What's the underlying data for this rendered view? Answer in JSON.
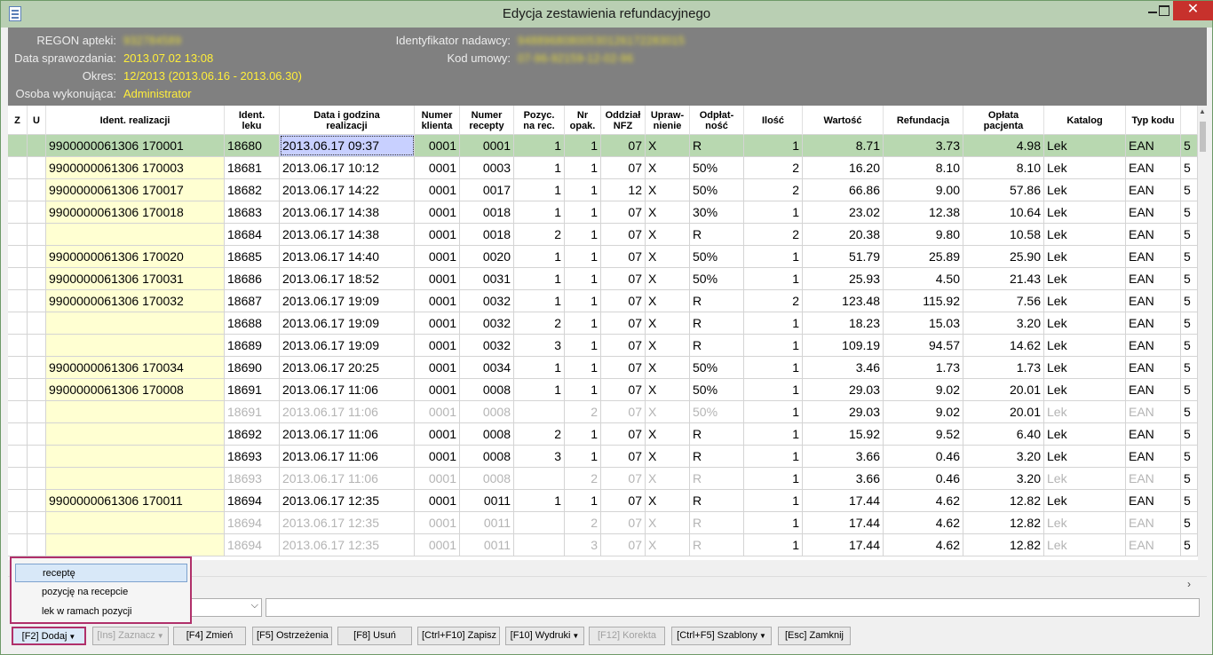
{
  "window": {
    "title": "Edycja zestawienia refundacyjnego"
  },
  "info": {
    "regon_label": "REGON apteki:",
    "regon_value": "932784589",
    "date_label": "Data sprawozdania:",
    "date_value": "2013.07.02 13:08",
    "period_label": "Okres:",
    "period_value": "12/2013 (2013.06.16 - 2013.06.30)",
    "person_label": "Osoba wykonująca:",
    "person_value": "Administrator",
    "sender_label": "Identyfikator nadawcy:",
    "sender_value": "94889680800530126172283015",
    "contract_label": "Kod umowy:",
    "contract_value": "07-96-92159-12-02-96"
  },
  "table": {
    "headers": [
      "Z",
      "U",
      "Ident. realizacji",
      "Ident.\nleku",
      "Data i godzina\nrealizacji",
      "Numer\nklienta",
      "Numer\nrecepty",
      "Pozyc.\nna rec.",
      "Nr\nopak.",
      "Oddział\nNFZ",
      "Upraw-\nnienie",
      "Odpłat-\nność",
      "Ilość",
      "Wartość",
      "Refundacja",
      "Opłata\npacjenta",
      "Katalog",
      "Typ kodu"
    ],
    "rows": [
      {
        "ident": "9900000061306  170001",
        "lek": "18680",
        "date": "2013.06.17 09:37",
        "klient": "0001",
        "recepta": "0001",
        "poz": "1",
        "opak": "1",
        "nfz": "07",
        "upr": "X",
        "odp": "R",
        "ilosc": "1",
        "wart": "8.71",
        "ref": "3.73",
        "opl": "4.98",
        "kat": "Lek",
        "typ": "EAN",
        "extra": "5"
      },
      {
        "ident": "9900000061306  170003",
        "lek": "18681",
        "date": "2013.06.17 10:12",
        "klient": "0001",
        "recepta": "0003",
        "poz": "1",
        "opak": "1",
        "nfz": "07",
        "upr": "X",
        "odp": "50%",
        "ilosc": "2",
        "wart": "16.20",
        "ref": "8.10",
        "opl": "8.10",
        "kat": "Lek",
        "typ": "EAN",
        "extra": "5"
      },
      {
        "ident": "9900000061306  170017",
        "lek": "18682",
        "date": "2013.06.17 14:22",
        "klient": "0001",
        "recepta": "0017",
        "poz": "1",
        "opak": "1",
        "nfz": "12",
        "upr": "X",
        "odp": "50%",
        "ilosc": "2",
        "wart": "66.86",
        "ref": "9.00",
        "opl": "57.86",
        "kat": "Lek",
        "typ": "EAN",
        "extra": "5"
      },
      {
        "ident": "9900000061306  170018",
        "lek": "18683",
        "date": "2013.06.17 14:38",
        "klient": "0001",
        "recepta": "0018",
        "poz": "1",
        "opak": "1",
        "nfz": "07",
        "upr": "X",
        "odp": "30%",
        "ilosc": "1",
        "wart": "23.02",
        "ref": "12.38",
        "opl": "10.64",
        "kat": "Lek",
        "typ": "EAN",
        "extra": "5"
      },
      {
        "ident": "",
        "lek": "18684",
        "date": "2013.06.17 14:38",
        "klient": "0001",
        "recepta": "0018",
        "poz": "2",
        "opak": "1",
        "nfz": "07",
        "upr": "X",
        "odp": "R",
        "ilosc": "2",
        "wart": "20.38",
        "ref": "9.80",
        "opl": "10.58",
        "kat": "Lek",
        "typ": "EAN",
        "extra": "5"
      },
      {
        "ident": "9900000061306  170020",
        "lek": "18685",
        "date": "2013.06.17 14:40",
        "klient": "0001",
        "recepta": "0020",
        "poz": "1",
        "opak": "1",
        "nfz": "07",
        "upr": "X",
        "odp": "50%",
        "ilosc": "1",
        "wart": "51.79",
        "ref": "25.89",
        "opl": "25.90",
        "kat": "Lek",
        "typ": "EAN",
        "extra": "5"
      },
      {
        "ident": "9900000061306  170031",
        "lek": "18686",
        "date": "2013.06.17 18:52",
        "klient": "0001",
        "recepta": "0031",
        "poz": "1",
        "opak": "1",
        "nfz": "07",
        "upr": "X",
        "odp": "50%",
        "ilosc": "1",
        "wart": "25.93",
        "ref": "4.50",
        "opl": "21.43",
        "kat": "Lek",
        "typ": "EAN",
        "extra": "5"
      },
      {
        "ident": "9900000061306  170032",
        "lek": "18687",
        "date": "2013.06.17 19:09",
        "klient": "0001",
        "recepta": "0032",
        "poz": "1",
        "opak": "1",
        "nfz": "07",
        "upr": "X",
        "odp": "R",
        "ilosc": "2",
        "wart": "123.48",
        "ref": "115.92",
        "opl": "7.56",
        "kat": "Lek",
        "typ": "EAN",
        "extra": "5"
      },
      {
        "ident": "",
        "lek": "18688",
        "date": "2013.06.17 19:09",
        "klient": "0001",
        "recepta": "0032",
        "poz": "2",
        "opak": "1",
        "nfz": "07",
        "upr": "X",
        "odp": "R",
        "ilosc": "1",
        "wart": "18.23",
        "ref": "15.03",
        "opl": "3.20",
        "kat": "Lek",
        "typ": "EAN",
        "extra": "5"
      },
      {
        "ident": "",
        "lek": "18689",
        "date": "2013.06.17 19:09",
        "klient": "0001",
        "recepta": "0032",
        "poz": "3",
        "opak": "1",
        "nfz": "07",
        "upr": "X",
        "odp": "R",
        "ilosc": "1",
        "wart": "109.19",
        "ref": "94.57",
        "opl": "14.62",
        "kat": "Lek",
        "typ": "EAN",
        "extra": "5"
      },
      {
        "ident": "9900000061306  170034",
        "lek": "18690",
        "date": "2013.06.17 20:25",
        "klient": "0001",
        "recepta": "0034",
        "poz": "1",
        "opak": "1",
        "nfz": "07",
        "upr": "X",
        "odp": "50%",
        "ilosc": "1",
        "wart": "3.46",
        "ref": "1.73",
        "opl": "1.73",
        "kat": "Lek",
        "typ": "EAN",
        "extra": "5"
      },
      {
        "ident": "9900000061306  170008",
        "lek": "18691",
        "date": "2013.06.17 11:06",
        "klient": "0001",
        "recepta": "0008",
        "poz": "1",
        "opak": "1",
        "nfz": "07",
        "upr": "X",
        "odp": "50%",
        "ilosc": "1",
        "wart": "29.03",
        "ref": "9.02",
        "opl": "20.01",
        "kat": "Lek",
        "typ": "EAN",
        "extra": "5"
      },
      {
        "ident": "",
        "lek": "18691",
        "date": "2013.06.17 11:06",
        "klient": "0001",
        "recepta": "0008",
        "poz": "",
        "opak": "2",
        "nfz": "07",
        "upr": "X",
        "odp": "50%",
        "ilosc": "1",
        "wart": "29.03",
        "ref": "9.02",
        "opl": "20.01",
        "kat": "Lek",
        "typ": "EAN",
        "extra": "5",
        "dim": true
      },
      {
        "ident": "",
        "lek": "18692",
        "date": "2013.06.17 11:06",
        "klient": "0001",
        "recepta": "0008",
        "poz": "2",
        "opak": "1",
        "nfz": "07",
        "upr": "X",
        "odp": "R",
        "ilosc": "1",
        "wart": "15.92",
        "ref": "9.52",
        "opl": "6.40",
        "kat": "Lek",
        "typ": "EAN",
        "extra": "5"
      },
      {
        "ident": "",
        "lek": "18693",
        "date": "2013.06.17 11:06",
        "klient": "0001",
        "recepta": "0008",
        "poz": "3",
        "opak": "1",
        "nfz": "07",
        "upr": "X",
        "odp": "R",
        "ilosc": "1",
        "wart": "3.66",
        "ref": "0.46",
        "opl": "3.20",
        "kat": "Lek",
        "typ": "EAN",
        "extra": "5"
      },
      {
        "ident": "",
        "lek": "18693",
        "date": "2013.06.17 11:06",
        "klient": "0001",
        "recepta": "0008",
        "poz": "",
        "opak": "2",
        "nfz": "07",
        "upr": "X",
        "odp": "R",
        "ilosc": "1",
        "wart": "3.66",
        "ref": "0.46",
        "opl": "3.20",
        "kat": "Lek",
        "typ": "EAN",
        "extra": "5",
        "dim": true
      },
      {
        "ident": "9900000061306  170011",
        "lek": "18694",
        "date": "2013.06.17 12:35",
        "klient": "0001",
        "recepta": "0011",
        "poz": "1",
        "opak": "1",
        "nfz": "07",
        "upr": "X",
        "odp": "R",
        "ilosc": "1",
        "wart": "17.44",
        "ref": "4.62",
        "opl": "12.82",
        "kat": "Lek",
        "typ": "EAN",
        "extra": "5"
      },
      {
        "ident": "",
        "lek": "18694",
        "date": "2013.06.17 12:35",
        "klient": "0001",
        "recepta": "0011",
        "poz": "",
        "opak": "2",
        "nfz": "07",
        "upr": "X",
        "odp": "R",
        "ilosc": "1",
        "wart": "17.44",
        "ref": "4.62",
        "opl": "12.82",
        "kat": "Lek",
        "typ": "EAN",
        "extra": "5",
        "dim": true
      },
      {
        "ident": "",
        "lek": "18694",
        "date": "2013.06.17 12:35",
        "klient": "0001",
        "recepta": "0011",
        "poz": "",
        "opak": "3",
        "nfz": "07",
        "upr": "X",
        "odp": "R",
        "ilosc": "1",
        "wart": "17.44",
        "ref": "4.62",
        "opl": "12.82",
        "kat": "Lek",
        "typ": "EAN",
        "extra": "5",
        "dim": true
      }
    ]
  },
  "popup_menu": {
    "items": [
      "receptę",
      "pozycję na recepcie",
      "lek w ramach pozycji"
    ]
  },
  "toolbar": {
    "add": "[F2] Dodaj",
    "mark": "[Ins] Zaznacz",
    "edit": "[F4] Zmień",
    "warnings": "[F5] Ostrzeżenia",
    "delete": "[F8] Usuń",
    "save": "[Ctrl+F10] Zapisz",
    "print": "[F10] Wydruki",
    "correct": "[F12] Korekta",
    "templates": "[Ctrl+F5] Szablony",
    "close": "[Esc] Zamknij"
  },
  "colors": {
    "title_bar": "#b9cfb3",
    "info_panel": "#808080",
    "info_value": "#ffee3a",
    "selected_row": "#b8d8b0",
    "ident_cell": "#ffffd2",
    "close_button": "#c7312c",
    "highlight_border": "#b0306a"
  }
}
